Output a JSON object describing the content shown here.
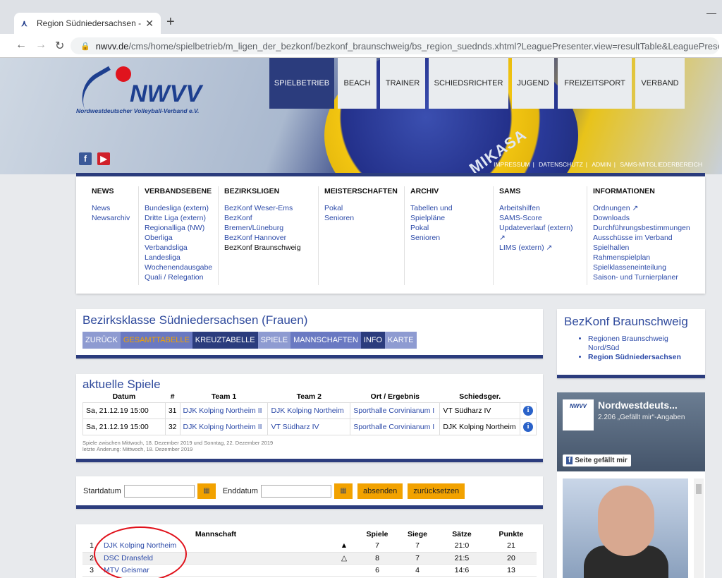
{
  "browser": {
    "tab_title": "Region Südniedersachsen - NWV",
    "url_domain": "nwvv.de",
    "url_path": "/cms/home/spielbetrieb/m_ligen_der_bezkonf/bezkonf_braunschweig/bs_region_suednds.xhtml?LeaguePresenter.view=resultTable&LeaguePresenter.ma..."
  },
  "logo": {
    "word": "NWVV",
    "subtitle": "Nordwestdeutscher Volleyball-Verband e.V."
  },
  "topnav": [
    "SPIELBETRIEB",
    "BEACH",
    "TRAINER",
    "SCHIEDSRICHTER",
    "JUGEND",
    "FREIZEITSPORT",
    "VERBAND"
  ],
  "metalinks": [
    "IMPRESSUM",
    "DATENSCHUTZ",
    "ADMIN",
    "SAMS-MITGLIEDERBEREICH"
  ],
  "mega": {
    "news": {
      "hd": "NEWS",
      "items": [
        "News",
        "Newsarchiv"
      ]
    },
    "verband": {
      "hd": "VERBANDSEBENE",
      "items": [
        "Bundesliga (extern)",
        "Dritte Liga (extern)",
        "Regionalliga (NW)",
        "Oberliga",
        "Verbandsliga",
        "Landesliga",
        "Wochenendausgabe",
        "Quali / Relegation"
      ]
    },
    "bezirk": {
      "hd": "BEZIRKSLIGEN",
      "items": [
        "BezKonf Weser-Ems",
        "BezKonf",
        "Bremen/Lüneburg",
        "BezKonf Hannover",
        "BezKonf Braunschweig"
      ]
    },
    "meister": {
      "hd": "MEISTERSCHAFTEN",
      "items": [
        "Pokal",
        "Senioren"
      ]
    },
    "archiv": {
      "hd": "ARCHIV",
      "items": [
        "Tabellen und",
        "Spielpläne",
        "Pokal",
        "Senioren"
      ]
    },
    "sams": {
      "hd": "SAMS",
      "items": [
        "Arbeitshilfen",
        "SAMS-Score",
        "Updateverlauf (extern)",
        "↗",
        "LIMS (extern) ↗"
      ]
    },
    "info": {
      "hd": "INFORMATIONEN",
      "items": [
        "Ordnungen ↗",
        "Downloads",
        "Durchführungsbestimmungen",
        "Ausschüsse im Verband",
        "Spielhallen",
        "Rahmenspielplan",
        "Spielklasseneinteilung",
        "Saison- und Turnierplaner"
      ]
    }
  },
  "league": {
    "title": "Bezirksklasse Südniedersachsen (Frauen)",
    "tabs": [
      "ZURÜCK",
      "GESAMTTABELLE",
      "KREUZTABELLE",
      "SPIELE",
      "MANNSCHAFTEN",
      "INFO",
      "KARTE"
    ]
  },
  "side": {
    "title": "BezKonf Braunschweig",
    "links": [
      "Regionen Braunschweig Nord/Süd",
      "Region Südniedersachsen"
    ]
  },
  "games": {
    "title": "aktuelle Spiele",
    "headers": [
      "Datum",
      "#",
      "Team 1",
      "Team 2",
      "Ort / Ergebnis",
      "Schiedsger."
    ],
    "rows": [
      [
        "Sa, 21.12.19 15:00",
        "31",
        "DJK Kolping Northeim II",
        "DJK Kolping Northeim",
        "Sporthalle Corvinianum I",
        "VT Südharz IV"
      ],
      [
        "Sa, 21.12.19 15:00",
        "32",
        "DJK Kolping Northeim II",
        "VT Südharz IV",
        "Sporthalle Corvinianum I",
        "DJK Kolping Northeim"
      ]
    ],
    "note1": "Spiele zwischen Mittwoch, 18. Dezember 2019 und Sonntag, 22. Dezember 2019",
    "note2": "letzte Änderung: Mittwoch, 18. Dezember 2019"
  },
  "filter": {
    "start_label": "Startdatum",
    "end_label": "Enddatum",
    "submit": "absenden",
    "reset": "zurücksetzen"
  },
  "standings": {
    "headers": [
      "",
      "Mannschaft",
      "",
      "Spiele",
      "Siege",
      "Sätze",
      "Punkte"
    ],
    "rows": [
      [
        "1",
        "DJK Kolping Northeim",
        "▲",
        "7",
        "7",
        "21:0",
        "21"
      ],
      [
        "2",
        "DSC Dransfeld",
        "△",
        "8",
        "7",
        "21:5",
        "20"
      ],
      [
        "3",
        "MTV Geismar",
        "",
        "6",
        "4",
        "14:6",
        "13"
      ]
    ]
  },
  "facebook": {
    "page_logo": "NWVV",
    "name": "Nordwestdeuts...",
    "likes": "2.206 „Gefällt mir“-Angaben",
    "like_btn": "Seite gefällt mir"
  },
  "colors": {
    "nav_dark": "#2b3c7d",
    "link": "#2c4aa8",
    "orange": "#f2a200",
    "annotation_red": "#e0101a"
  }
}
